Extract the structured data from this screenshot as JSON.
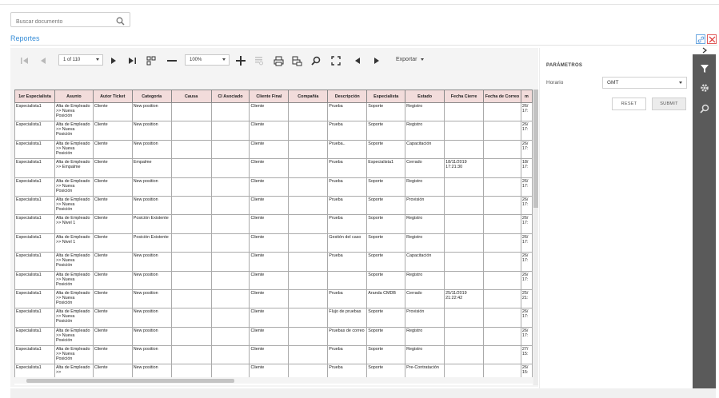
{
  "search": {
    "placeholder": "Buscar documento"
  },
  "page": {
    "title": "Reportes"
  },
  "toolbar": {
    "page_indicator": "1 of 110",
    "zoom": "100%",
    "export_label": "Exportar"
  },
  "params": {
    "title": "PARÁMETROS",
    "horario_label": "Horario",
    "horario_value": "GMT",
    "reset_label": "RESET",
    "submit_label": "SUBMIT"
  },
  "colors": {
    "accent": "#3a8fd8",
    "header_bg": "#f2dcdb",
    "sidebar_bg": "#5a5a5a"
  },
  "table": {
    "headers": [
      "1er Especialista",
      "Asunto",
      "Autor Ticket",
      "Categoría",
      "Causa",
      "CI Asociado",
      "Cliente Final",
      "Compañía",
      "Descripción",
      "Especialista",
      "Estado",
      "Fecha Cierre",
      "Fecha de Correo",
      "m"
    ],
    "rows": [
      [
        "Especialista1",
        "Alta de Empleado >> Nueva Posición",
        "Cliente",
        "New position",
        "",
        "",
        "Cliente",
        "",
        "Prueba",
        "Soporte",
        "Registro",
        "",
        "",
        "26/ 17:"
      ],
      [
        "Especialista1",
        "Alta de Empleado >> Nueva Posición",
        "Cliente",
        "New position",
        "",
        "",
        "Cliente",
        "",
        "Prueba",
        "Soporte",
        "Registro",
        "",
        "",
        "26/ 17:"
      ],
      [
        "Especialista1",
        "Alta de Empleado >> Nueva Posición",
        "Cliente",
        "New position",
        "",
        "",
        "Cliente",
        "",
        "Prueba..",
        "Soporte",
        "Capacitación",
        "",
        "",
        "26/ 17:"
      ],
      [
        "Especialista1",
        "Alta de Empleado >> Empalme",
        "Cliente",
        "Empalme",
        "",
        "",
        "Cliente",
        "",
        "Prueba",
        "Especialista1",
        "Cerrado",
        "18/11/2019 17:21:30",
        "",
        "18/ 17:"
      ],
      [
        "Especialista1",
        "Alta de Empleado >> Nueva Posición",
        "Cliente",
        "New position",
        "",
        "",
        "Cliente",
        "",
        "Prueba",
        "Soporte",
        "Registro",
        "",
        "",
        "26/ 17:"
      ],
      [
        "Especialista1",
        "Alta de Empleado >> Nueva Posición",
        "Cliente",
        "New position",
        "",
        "",
        "Cliente",
        "",
        "Prueba",
        "Soporte",
        "Provisión",
        "",
        "",
        "26/ 17:"
      ],
      [
        "Especialista1",
        "Alta de Empleado >> Nivel 1",
        "Cliente",
        "Posición Existente",
        "",
        "",
        "Cliente",
        "",
        "Prueba",
        "Soporte",
        "Registro",
        "",
        "",
        "26/ 17:"
      ],
      [
        "Especialista1",
        "Alta de Empleado >> Nivel 1",
        "Cliente",
        "Posición Existente",
        "",
        "",
        "Cliente",
        "",
        "Gestión del caso",
        "Soporte",
        "Registro",
        "",
        "",
        "26/ 17:"
      ],
      [
        "Especialista1",
        "Alta de Empleado >> Nueva Posición",
        "Cliente",
        "New position",
        "",
        "",
        "Cliente",
        "",
        "Prueba",
        "Soporte",
        "Capacitación",
        "",
        "",
        "26/ 17:"
      ],
      [
        "Especialista1",
        "Alta de Empleado >> Nueva Posición",
        "Cliente",
        "New position",
        "",
        "",
        "Cliente",
        "",
        "",
        "Soporte",
        "Registro",
        "",
        "",
        "26/ 17:"
      ],
      [
        "Especialista1",
        "Alta de Empleado >> Nueva Posición",
        "Cliente",
        "New position",
        "",
        "",
        "Cliente",
        "",
        "Prueba",
        "Aranda CMDB",
        "Cerrado",
        "25/11/2019 21:22:42",
        "",
        "25/ 21:"
      ],
      [
        "Especialista1",
        "Alta de Empleado >> Nueva Posición",
        "Cliente",
        "New position",
        "",
        "",
        "Cliente",
        "",
        "Flujo de pruebas",
        "Soporte",
        "Provisión",
        "",
        "",
        "26/ 17:"
      ],
      [
        "Especialista1",
        "Alta de Empleado >> Nueva Posición",
        "Cliente",
        "New position",
        "",
        "",
        "Cliente",
        "",
        "Pruebas de correo",
        "Soporte",
        "Registro",
        "",
        "",
        "26/ 17:"
      ],
      [
        "Especialista1",
        "Alta de Empleado >> Nueva Posición",
        "Cliente",
        "New position",
        "",
        "",
        "Cliente",
        "",
        "Prueba",
        "Soporte",
        "Registro",
        "",
        "",
        "27/ 15:"
      ],
      [
        "Especialista1",
        "Alta de Empleado >>",
        "Cliente",
        "New position",
        "",
        "",
        "Cliente",
        "",
        "Prueba",
        "Soporte",
        "Pre-Contratación",
        "",
        "",
        "26/ 15:"
      ]
    ]
  }
}
